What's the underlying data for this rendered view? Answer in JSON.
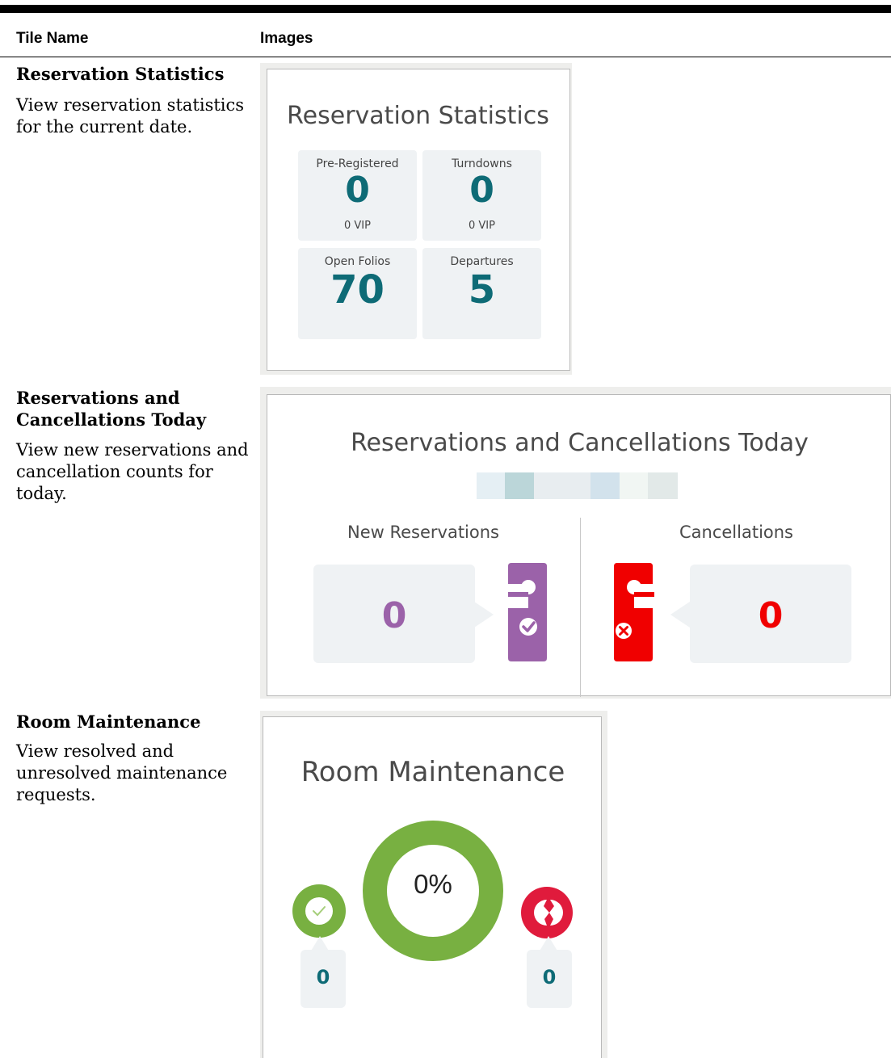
{
  "table": {
    "headers": {
      "name": "Tile Name",
      "images": "Images"
    },
    "rows": [
      {
        "name": "Reservation Statistics",
        "description": "View reservation statistics for the current date."
      },
      {
        "name": "Reservations and Cancellations Today",
        "description": "View new reservations and cancellation counts for today."
      },
      {
        "name": "Room Maintenance",
        "description": "View resolved and unresolved maintenance requests."
      }
    ]
  },
  "reservation_statistics": {
    "title": "Reservation Statistics",
    "stats": [
      {
        "label": "Pre-Registered",
        "value": "0",
        "sub": "0 VIP"
      },
      {
        "label": "Turndowns",
        "value": "0",
        "sub": "0 VIP"
      },
      {
        "label": "Open Folios",
        "value": "70"
      },
      {
        "label": "Departures",
        "value": "5"
      }
    ],
    "value_color": "#0e6b76"
  },
  "reservations_cancellations": {
    "title": "Reservations and Cancellations Today",
    "new_reservations": {
      "label": "New Reservations",
      "value": "0",
      "color": "#9b62a9",
      "icon": "door-hanger-check-icon"
    },
    "cancellations": {
      "label": "Cancellations",
      "value": "0",
      "color": "#f00000",
      "icon": "door-hanger-x-icon"
    }
  },
  "room_maintenance": {
    "title": "Room Maintenance",
    "percent_label": "0%",
    "resolved": {
      "value": "0",
      "color": "#78b041",
      "icon": "check-circle-icon"
    },
    "unresolved": {
      "value": "0",
      "color": "#e01b3c",
      "icon": "broken-circle-icon"
    }
  }
}
